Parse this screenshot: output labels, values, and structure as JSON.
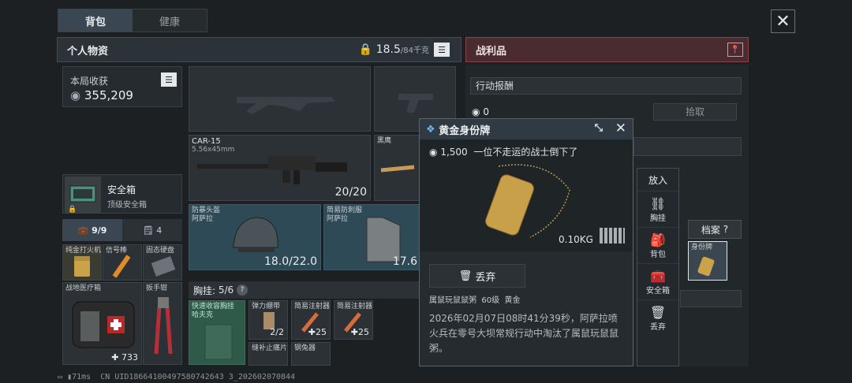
{
  "tabs": [
    "背包",
    "健康"
  ],
  "personal": {
    "title": "个人物资",
    "weight": "18.5",
    "weight_max": "/84千克"
  },
  "earnings": {
    "label": "本局收获",
    "value": "355,209"
  },
  "safebox": {
    "name": "安全箱",
    "desc": "顶级安全箱"
  },
  "inv_tabs": {
    "a": "9/9",
    "b": "4"
  },
  "small_items": [
    {
      "name": "纯金打火机"
    },
    {
      "name": "信号棒"
    },
    {
      "name": "固态硬盘"
    },
    {
      "name": "战地医疗箱",
      "count": "733"
    },
    {
      "name": "扳手钳"
    }
  ],
  "weapon": {
    "name": "CAR-15",
    "ammo": "5.56x45mm",
    "count": "20/20"
  },
  "bullet_label": "黑鹰",
  "helmet": {
    "name": "防暴头盔",
    "sub": "阿萨拉",
    "dur": "18.0/22.0"
  },
  "armor": {
    "name": "简易防刺服",
    "sub": "阿萨拉",
    "dur": "17.6"
  },
  "rig": {
    "label": "胸挂:",
    "count": "5/6",
    "help": "?"
  },
  "rig_items": [
    {
      "name": "快速收容胸挂",
      "sub": "哈夫克"
    },
    {
      "name": "弹力绷带",
      "count": "2/2"
    },
    {
      "name": "简易注射器",
      "count": "25"
    },
    {
      "name": "简易注射器",
      "count": "25"
    },
    {
      "name": "缝补止痛片"
    },
    {
      "name": "钢兔器"
    }
  ],
  "loot": {
    "title": "战利品",
    "reward_label": "行动报酬",
    "reward_value": "0",
    "pickup": "拾取"
  },
  "archive": {
    "label": "档案",
    "help": "?",
    "item": "身份牌"
  },
  "popup": {
    "title": "黄金身份牌",
    "price": "1,500",
    "quote": "一位不走运的战士倒下了",
    "weight": "0.10KG",
    "discard": "丢弃",
    "owner": "属鼠玩鼠鼠粥",
    "level": "60级",
    "rank": "黄金",
    "desc": "2026年02月07日08时41分39秒，阿萨拉喷火兵在零号大坝常规行动中淘汰了属鼠玩鼠鼠粥。"
  },
  "actions": {
    "title": "放入",
    "items": [
      "胸挂",
      "背包",
      "安全箱",
      "丢弃"
    ]
  },
  "status": {
    "ping": "71ms",
    "uid": "CN UID18664100497580742643 3_202602070844"
  }
}
